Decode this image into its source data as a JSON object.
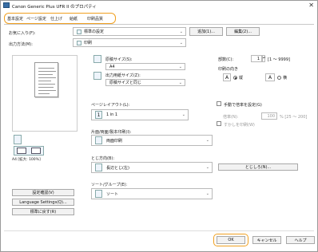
{
  "title": "Canon Generic Plus UFR II のプロパティ",
  "close_glyph": "✕",
  "tabs": [
    "基本設定",
    "ページ設定",
    "仕上げ",
    "給紙",
    "印刷品質"
  ],
  "profile_label": "お気に入り(F):",
  "profile_value": "標準の設定",
  "add_btn": "追加(1)...",
  "edit_btn": "編集(2)...",
  "output_label": "出力方法(M):",
  "output_value": "印刷",
  "page_size_label": "原稿サイズ(S):",
  "page_size_value": "A4",
  "output_size_label": "出力用紙サイズ(Z):",
  "output_size_value": "原稿サイズと同じ",
  "copies_label": "部数(C):",
  "copies_value": "1",
  "copies_range": "[1 〜 9999]",
  "orientation_label": "印刷の向き",
  "portrait_label": "縦",
  "landscape_label": "横",
  "layout_label": "ページレイアウト(L):",
  "layout_value": "1 in 1",
  "scale_label": "手動で倍率を設定(G)",
  "scale_field_label": "倍率(N):",
  "scale_value": "100",
  "scale_range": "% [25 〜 200]",
  "watermark_label": "すかしを印刷(W)",
  "duplex_label": "片面/両面/製本印刷(I):",
  "duplex_value": "両面印刷",
  "binding_label": "とじ方向(B):",
  "binding_value": "長辺とじ(左)",
  "binding_btn": "とじしろ(N)...",
  "collate_label": "ソート/グループ(E):",
  "collate_value": "ソート",
  "preview_caption": "A4 [拡大: 100%]",
  "btn_view_settings": "設定確認(V)",
  "btn_language": "Language Settings(Q)...",
  "btn_restore": "標準に戻す(R)",
  "ok_btn": "OK",
  "cancel_btn": "キャンセル",
  "help_btn": "ヘルプ"
}
